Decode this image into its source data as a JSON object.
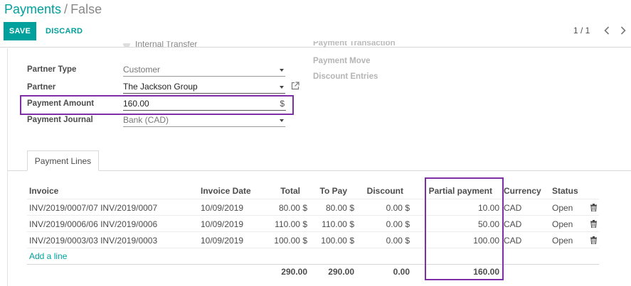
{
  "breadcrumb": {
    "parent": "Payments",
    "separator": "/",
    "current": "False"
  },
  "toolbar": {
    "save_label": "SAVE",
    "discard_label": "DISCARD"
  },
  "pager": {
    "value": "1 / 1",
    "prev_icon": "chevron-left-icon",
    "next_icon": "chevron-right-icon"
  },
  "form": {
    "faded_radio_label": "Internal Transfer",
    "faded_right_label": "Payment Transaction",
    "right_labels": [
      "Payment Move",
      "Discount Entries"
    ],
    "partner_type": {
      "label": "Partner Type",
      "value": "Customer"
    },
    "partner": {
      "label": "Partner",
      "value": "The Jackson Group"
    },
    "payment_amount": {
      "label": "Payment Amount",
      "value": "160.00",
      "currency_symbol": "$"
    },
    "payment_journal": {
      "label": "Payment Journal",
      "value": "Bank (CAD)"
    }
  },
  "tabs": [
    {
      "label": "Payment Lines",
      "active": true
    }
  ],
  "table": {
    "columns": [
      "Invoice",
      "Invoice Date",
      "Total",
      "To Pay",
      "Discount",
      "Partial payment",
      "Currency",
      "Status"
    ],
    "rows": [
      {
        "invoice": "INV/2019/0007/07 INV/2019/0007",
        "date": "10/09/2019",
        "total": "80.00 $",
        "to_pay": "80.00 $",
        "discount": "0.00 $",
        "partial": "10.00",
        "currency": "CAD",
        "status": "Open"
      },
      {
        "invoice": "INV/2019/0006/06 INV/2019/0006",
        "date": "10/09/2019",
        "total": "110.00 $",
        "to_pay": "110.00 $",
        "discount": "0.00 $",
        "partial": "50.00",
        "currency": "CAD",
        "status": "Open"
      },
      {
        "invoice": "INV/2019/0003/03 INV/2019/0003",
        "date": "10/09/2019",
        "total": "100.00 $",
        "to_pay": "100.00 $",
        "discount": "0.00 $",
        "partial": "100.00",
        "currency": "CAD",
        "status": "Open"
      }
    ],
    "add_line_label": "Add a line",
    "totals": {
      "total": "290.00",
      "to_pay": "290.00",
      "discount": "0.00",
      "partial": "160.00"
    }
  },
  "colors": {
    "accent": "#00a09d",
    "highlight": "#7e2fa6"
  }
}
